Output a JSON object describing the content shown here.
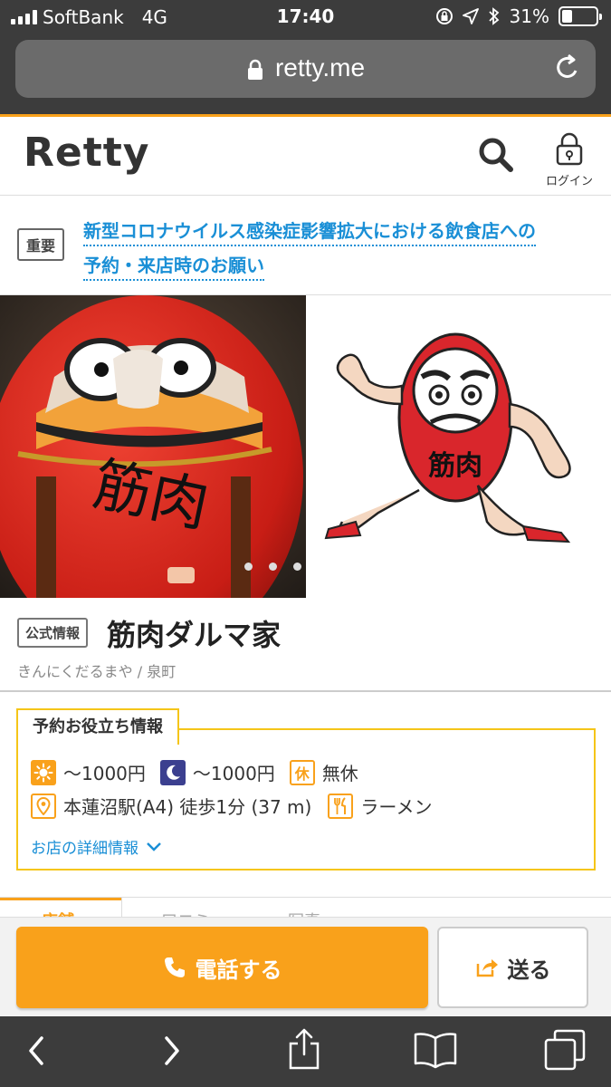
{
  "status": {
    "carrier": "SoftBank",
    "network": "4G",
    "time": "17:40",
    "battery": "31%",
    "battery_level": 0.31
  },
  "browser": {
    "url": "retty.me"
  },
  "header": {
    "logo": "Retty",
    "login_label": "ログイン"
  },
  "notice": {
    "badge": "重要",
    "line1": "新型コロナウイルス感染症影響拡大における飲食店への",
    "line2": "予約・来店時のお願い"
  },
  "shop": {
    "official_badge": "公式情報",
    "name": "筋肉ダルマ家",
    "reading_area": "きんにくだるまや / 泉町",
    "daruma_text": "筋肉"
  },
  "info": {
    "tag": "予約お役立ち情報",
    "lunch_price": "〜1000円",
    "dinner_price": "〜1000円",
    "holiday_icon": "休",
    "holiday": "無休",
    "access": "本蓮沼駅(A4) 徒歩1分 (37 m)",
    "genre": "ラーメン",
    "detail_link": "お店の詳細情報"
  },
  "tabs": [
    "店舗",
    "口コミ",
    "写真"
  ],
  "actions": {
    "call": "電話する",
    "send": "送る"
  },
  "colors": {
    "accent": "#f9a11b",
    "link": "#1a8fd6",
    "info_border": "#f5c518",
    "chrome": "#3c3c3c"
  }
}
